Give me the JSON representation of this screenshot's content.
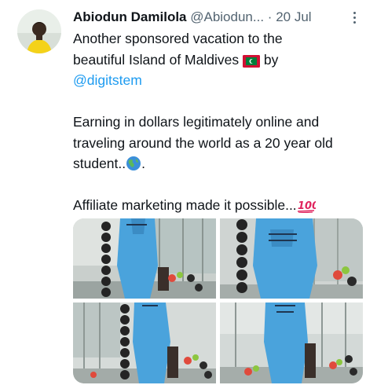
{
  "tweet": {
    "author_name": "Abiodun Damilola",
    "author_handle": "@Abiodun...",
    "separator": "·",
    "date": "20 Jul",
    "line1": "Another sponsored vacation to the",
    "line2_prefix": "beautiful Island of Maldives",
    "line2_suffix": "by",
    "mention": "@digitstem",
    "para2_line1": "Earning in dollars legitimately online and",
    "para2_line2": "traveling around the world as a 20 year old",
    "para2_line3": "student..",
    "para2_line3_end": ".",
    "para3": "Affiliate marketing made it possible...",
    "emoji": [
      "maldives-flag-icon",
      "globe-icon",
      "hundred-points-icon"
    ]
  },
  "colors": {
    "accent": "#1d9bf0",
    "text": "#0f1419",
    "secondary": "#536471",
    "outfit": "#4aa3dc"
  }
}
